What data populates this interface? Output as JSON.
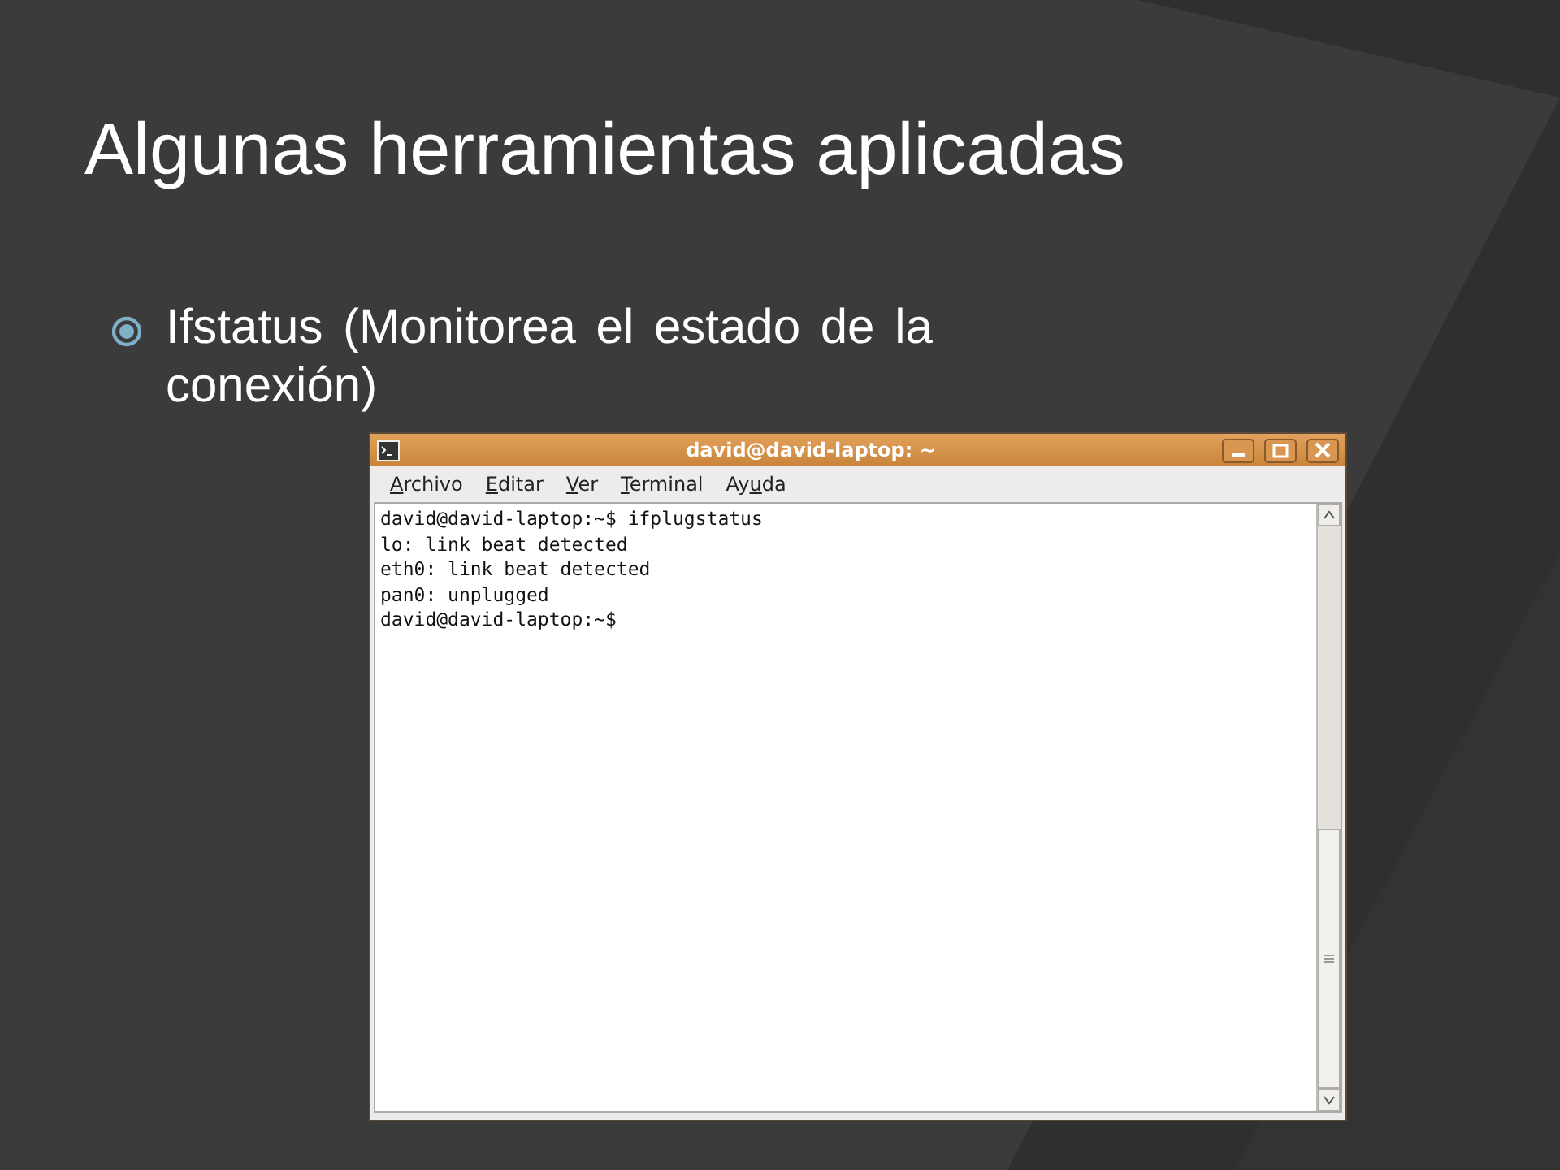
{
  "slide": {
    "title": "Algunas herramientas aplicadas",
    "bullets": [
      {
        "text": "Ifstatus (Monitorea el estado de la conexión)"
      }
    ]
  },
  "terminal": {
    "title": "david@david-laptop: ~",
    "menu": [
      {
        "key": "A",
        "after": "rchivo"
      },
      {
        "key": "E",
        "after": "ditar"
      },
      {
        "key": "V",
        "after": "er"
      },
      {
        "key": "T",
        "after": "erminal"
      },
      {
        "before": "Ay",
        "key": "u",
        "after": "da"
      }
    ],
    "lines": [
      "david@david-laptop:~$ ifplugstatus",
      "lo: link beat detected",
      "eth0: link beat detected",
      "pan0: unplugged",
      "david@david-laptop:~$"
    ]
  }
}
